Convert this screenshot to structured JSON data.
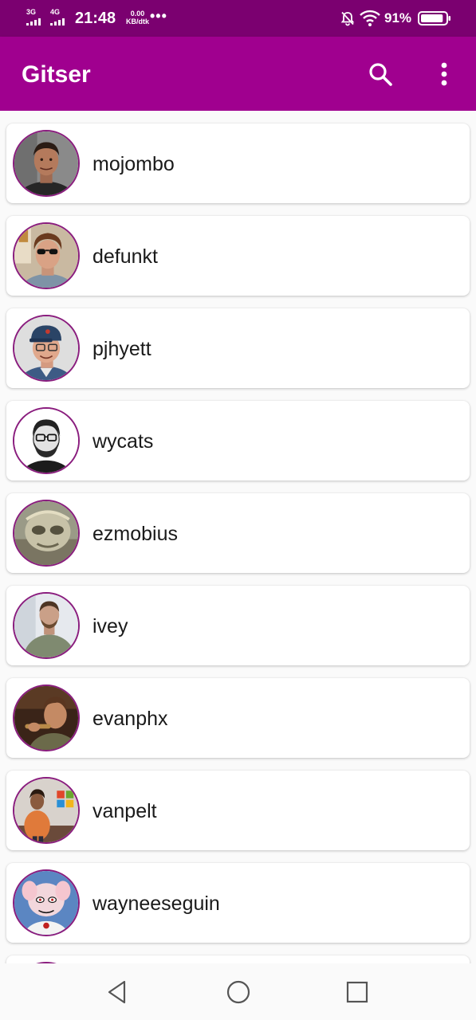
{
  "status_bar": {
    "sim1_tech": "3G",
    "sim2_tech": "4G",
    "time": "21:48",
    "net_speed_value": "0.00",
    "net_speed_unit": "KB/dtk",
    "more_dots": "•••",
    "battery_percent": "91%",
    "battery_level": 0.91,
    "icons": [
      "signal-icon",
      "signal-icon",
      "bell-off-icon",
      "wifi-icon",
      "battery-icon"
    ]
  },
  "app_bar": {
    "title": "Gitser",
    "actions": [
      "search-icon",
      "more-vert-icon"
    ]
  },
  "colors": {
    "status_bar": "#7b0070",
    "app_bar": "#a0008f",
    "avatar_border": "#8a1d7e"
  },
  "users": [
    {
      "login": "mojombo"
    },
    {
      "login": "defunkt"
    },
    {
      "login": "pjhyett"
    },
    {
      "login": "wycats"
    },
    {
      "login": "ezmobius"
    },
    {
      "login": "ivey"
    },
    {
      "login": "evanphx"
    },
    {
      "login": "vanpelt"
    },
    {
      "login": "wayneeseguin"
    },
    {
      "login": ""
    }
  ],
  "nav_bar": {
    "buttons": [
      "back-icon",
      "home-icon",
      "recents-icon"
    ]
  }
}
